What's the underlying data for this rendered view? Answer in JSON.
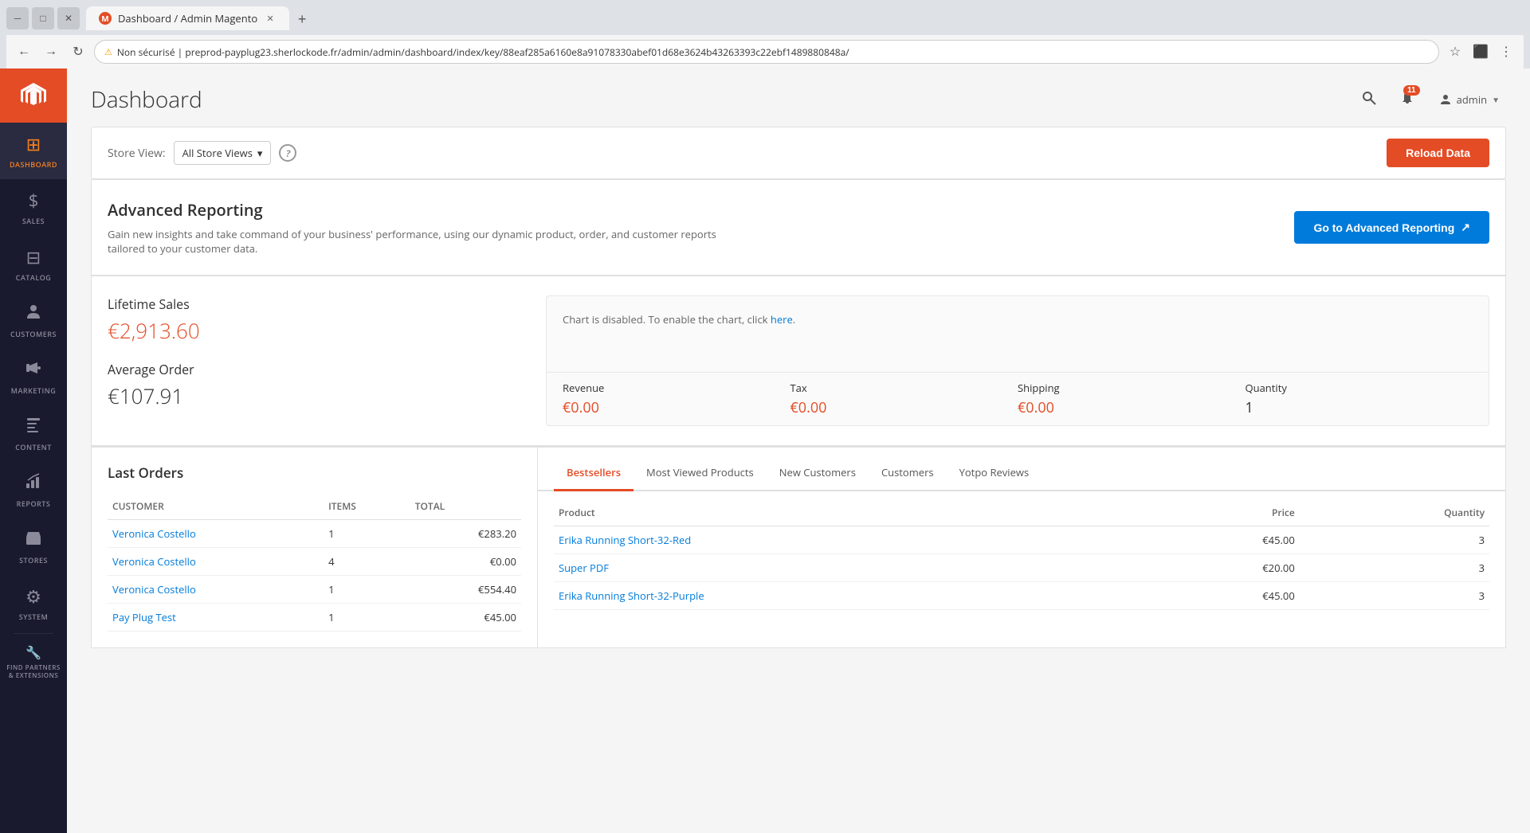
{
  "browser": {
    "tab_title": "Dashboard / Admin Magento",
    "url": "Non sécurisé  |  preprod-payplug23.sherlockode.fr/admin/admin/dashboard/index/key/88eaf285a6160e8a91078330abef01d68e3624b43263393c22ebf1489880848a/",
    "new_tab_label": "+"
  },
  "sidebar": {
    "logo_letter": "M",
    "items": [
      {
        "id": "dashboard",
        "label": "DASHBOARD",
        "icon": "⬛",
        "active": true
      },
      {
        "id": "sales",
        "label": "SALES",
        "icon": "$"
      },
      {
        "id": "catalog",
        "label": "CATALOG",
        "icon": "▦"
      },
      {
        "id": "customers",
        "label": "CUSTOMERS",
        "icon": "👤"
      },
      {
        "id": "marketing",
        "label": "MARKETING",
        "icon": "📣"
      },
      {
        "id": "content",
        "label": "CONTENT",
        "icon": "◩"
      },
      {
        "id": "reports",
        "label": "REPORTS",
        "icon": "📊"
      },
      {
        "id": "stores",
        "label": "STORES",
        "icon": "🏪"
      },
      {
        "id": "system",
        "label": "SYSTEM",
        "icon": "⚙"
      },
      {
        "id": "extensions",
        "label": "FIND PARTNERS & EXTENSIONS",
        "icon": "🔧"
      }
    ]
  },
  "header": {
    "title": "Dashboard",
    "notifications_count": "11",
    "user_name": "admin",
    "search_placeholder": "Search"
  },
  "store_view": {
    "label": "Store View:",
    "selected": "All Store Views",
    "reload_label": "Reload Data",
    "help_label": "?"
  },
  "advanced_reporting": {
    "title": "Advanced Reporting",
    "description": "Gain new insights and take command of your business' performance, using our dynamic product, order, and customer reports tailored to your customer data.",
    "button_label": "Go to Advanced Reporting",
    "button_icon": "↗"
  },
  "lifetime_sales": {
    "label": "Lifetime Sales",
    "value": "€2,913.60"
  },
  "average_order": {
    "label": "Average Order",
    "value": "€107.91"
  },
  "chart": {
    "disabled_msg": "Chart is disabled. To enable the chart, click",
    "link_text": "here",
    "metrics": [
      {
        "label": "Revenue",
        "value": "€0.00"
      },
      {
        "label": "Tax",
        "value": "€0.00"
      },
      {
        "label": "Shipping",
        "value": "€0.00"
      },
      {
        "label": "Quantity",
        "value": "1",
        "dark": true
      }
    ]
  },
  "last_orders": {
    "title": "Last Orders",
    "columns": [
      "Customer",
      "Items",
      "Total"
    ],
    "rows": [
      {
        "customer": "Veronica Costello",
        "items": "1",
        "total": "€283.20"
      },
      {
        "customer": "Veronica Costello",
        "items": "4",
        "total": "€0.00"
      },
      {
        "customer": "Veronica Costello",
        "items": "1",
        "total": "€554.40"
      },
      {
        "customer": "Pay Plug Test",
        "items": "1",
        "total": "€45.00"
      }
    ]
  },
  "tabs": [
    {
      "id": "bestsellers",
      "label": "Bestsellers",
      "active": true
    },
    {
      "id": "most-viewed",
      "label": "Most Viewed Products"
    },
    {
      "id": "new-customers",
      "label": "New Customers"
    },
    {
      "id": "customers",
      "label": "Customers"
    },
    {
      "id": "yotpo",
      "label": "Yotpo Reviews"
    }
  ],
  "bestsellers_table": {
    "columns": [
      "Product",
      "Price",
      "Quantity"
    ],
    "rows": [
      {
        "product": "Erika Running Short-32-Red",
        "price": "€45.00",
        "quantity": "3"
      },
      {
        "product": "Super PDF",
        "price": "€20.00",
        "quantity": "3"
      },
      {
        "product": "Erika Running Short-32-Purple",
        "price": "€45.00",
        "quantity": "3"
      }
    ]
  }
}
